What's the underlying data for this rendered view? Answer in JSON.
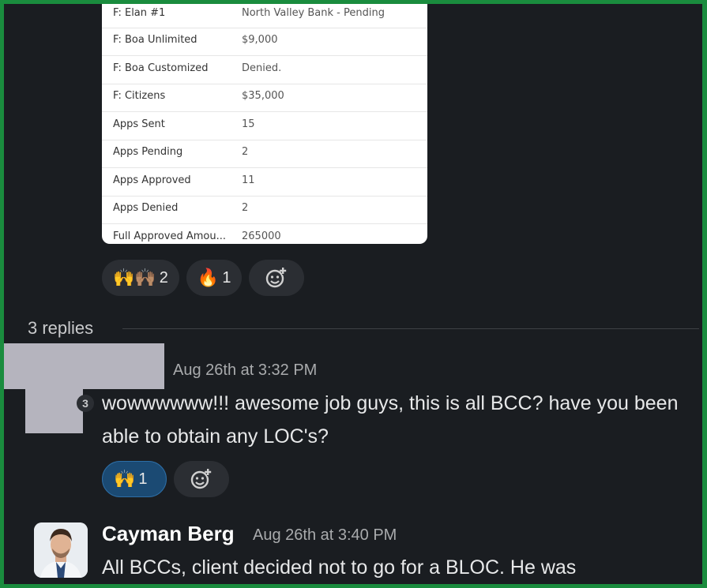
{
  "table": {
    "rows": [
      {
        "key": "F: Elan #1",
        "value": "North Valley Bank - Pending"
      },
      {
        "key": "F: Boa Unlimited",
        "value": "$9,000"
      },
      {
        "key": "F: Boa Customized",
        "value": "Denied."
      },
      {
        "key": "F: Citizens",
        "value": "$35,000"
      },
      {
        "key": "Apps Sent",
        "value": "15"
      },
      {
        "key": "Apps Pending",
        "value": "2"
      },
      {
        "key": "Apps Approved",
        "value": "11"
      },
      {
        "key": "Apps Denied",
        "value": "2"
      },
      {
        "key": "Full Approved Amou...",
        "value": "265000"
      }
    ]
  },
  "reactions1": [
    {
      "emoji": "🙌🙌🏽",
      "count": "2"
    },
    {
      "emoji": "🔥",
      "count": "1"
    }
  ],
  "thread": {
    "replies_label": "3 replies"
  },
  "message1": {
    "time": "Aug 26th at 3:32 PM",
    "badge": "3",
    "text": "wowwwwww!!! awesome job guys, this is all BCC? have you been able to obtain any LOC's?",
    "reaction": {
      "emoji": "🙌",
      "count": "1"
    }
  },
  "message2": {
    "author": "Cayman Berg",
    "time": "Aug 26th at 3:40 PM",
    "text": "All BCCs, client decided not to go for a BLOC. He was"
  },
  "icons": {
    "add_reaction": "add-reaction-icon"
  },
  "colors": {
    "frame": "#1a8c3e",
    "background": "#1a1d21",
    "active_reaction": "#1b4a73"
  }
}
